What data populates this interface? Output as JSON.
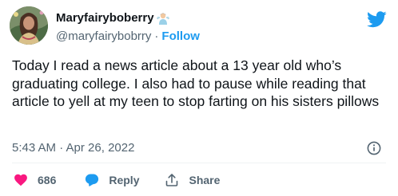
{
  "author": {
    "display_name": "Maryfairyboberry",
    "name_emoji": "fairy-emoji",
    "handle": "@maryfairybobrry",
    "separator": "·",
    "follow_label": "Follow"
  },
  "tweet": {
    "text": "Today I read a news article about a 13 year old who’s graduating college. I also had to pause while reading that article to yell at my teen to stop farting on his sisters pillows",
    "timestamp": "5:43 AM · Apr 26, 2022"
  },
  "actions": {
    "like_count": "686",
    "reply_label": "Reply",
    "share_label": "Share"
  },
  "icons": {
    "brand": "twitter-bird-icon",
    "like": "heart-icon",
    "reply": "speech-bubble-icon",
    "share": "share-upload-icon",
    "info": "info-circle-icon"
  },
  "colors": {
    "brand_blue": "#1d9bf0",
    "heart_red": "#f91880",
    "text_primary": "#0f1419",
    "text_secondary": "#536471"
  }
}
